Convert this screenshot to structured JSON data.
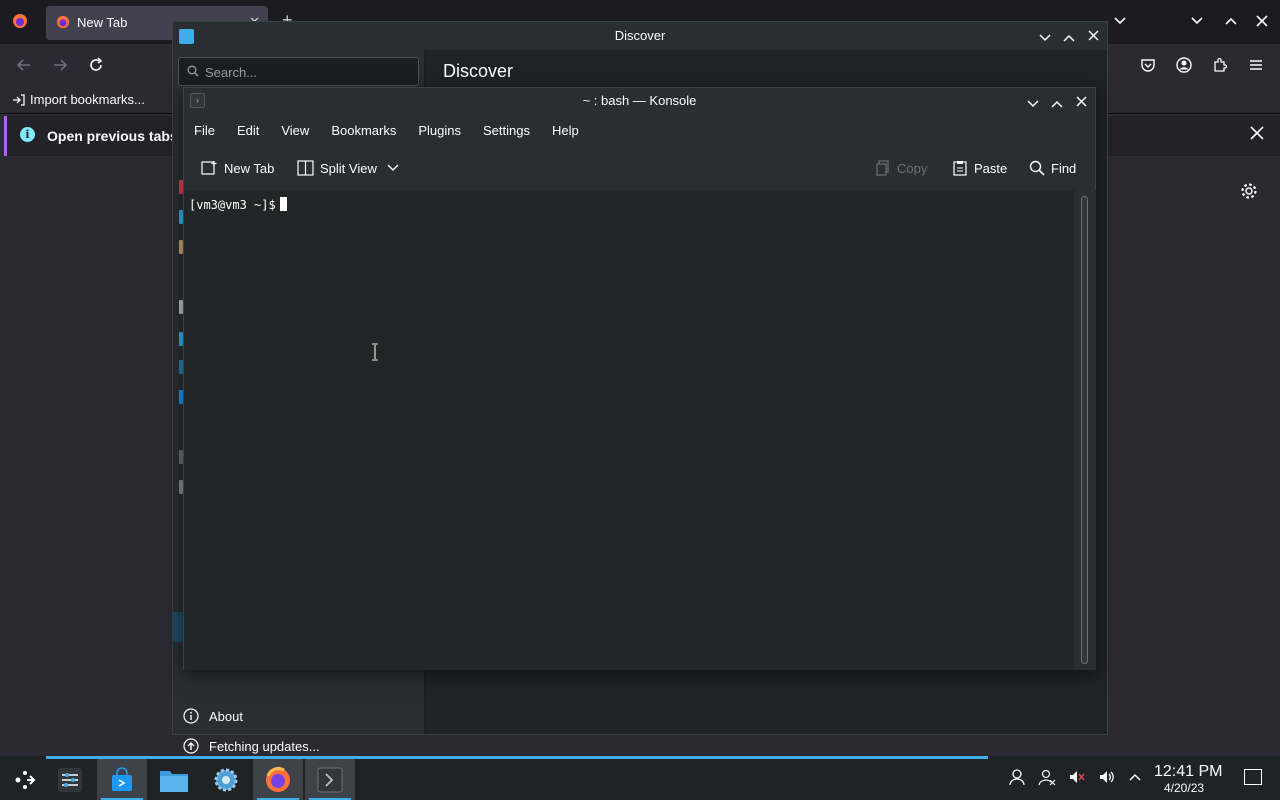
{
  "firefox": {
    "tab_title": "New Tab",
    "import_bookmarks": "Import bookmarks...",
    "infobar_text": "Open previous tabs"
  },
  "discover": {
    "window_title": "Discover",
    "search_placeholder": "Search...",
    "page_title": "Discover",
    "about_label": "About",
    "fetching_label": "Fetching updates..."
  },
  "konsole": {
    "window_title": "~ : bash — Konsole",
    "menu": [
      "File",
      "Edit",
      "View",
      "Bookmarks",
      "Plugins",
      "Settings",
      "Help"
    ],
    "toolbar": {
      "new_tab": "New Tab",
      "split_view": "Split View",
      "copy": "Copy",
      "paste": "Paste",
      "find": "Find"
    },
    "prompt": "[vm3@vm3 ~]$"
  },
  "taskbar": {
    "clock_time": "12:41 PM",
    "clock_date": "4/20/23"
  },
  "colors": {
    "accent": "#3daee9",
    "window_bg": "#2a2e32",
    "terminal_bg": "#232627",
    "firefox_dark": "#1c1b22"
  }
}
